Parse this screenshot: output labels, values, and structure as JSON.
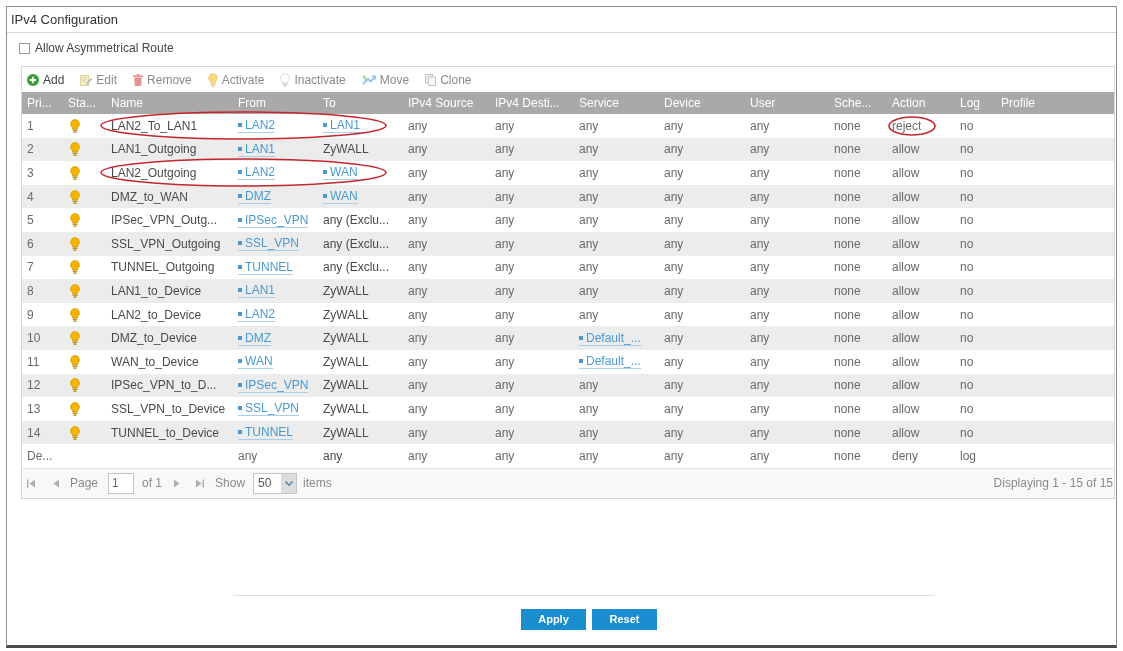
{
  "panel": {
    "title": "IPv4 Configuration"
  },
  "asymmetrical_route": {
    "label": "Allow Asymmetrical Route",
    "checked": false
  },
  "toolbar": [
    {
      "kind": "add",
      "label": "Add",
      "disabled": false
    },
    {
      "kind": "edit",
      "label": "Edit",
      "disabled": true
    },
    {
      "kind": "remove",
      "label": "Remove",
      "disabled": true
    },
    {
      "kind": "activate",
      "label": "Activate",
      "disabled": true
    },
    {
      "kind": "inactivate",
      "label": "Inactivate",
      "disabled": true
    },
    {
      "kind": "move",
      "label": "Move",
      "disabled": true
    },
    {
      "kind": "clone",
      "label": "Clone",
      "disabled": true
    }
  ],
  "table": {
    "columns": [
      "Pri...",
      "Sta...",
      "Name",
      "From",
      "To",
      "IPv4 Source",
      "IPv4 Desti...",
      "Service",
      "Device",
      "User",
      "Sche...",
      "Action",
      "Log",
      "Profile"
    ],
    "rows": [
      {
        "circled": true,
        "action_circled": true,
        "cells": [
          "1",
          {
            "kind": "bulb",
            "on": true
          },
          "LAN2_To_LAN1",
          {
            "kind": "link",
            "text": "LAN2"
          },
          {
            "kind": "link",
            "text": "LAN1"
          },
          "any",
          "any",
          "any",
          "any",
          "any",
          "none",
          "reject",
          "no"
        ]
      },
      {
        "circled": false,
        "action_circled": false,
        "cells": [
          "2",
          {
            "kind": "bulb",
            "on": true
          },
          "LAN1_Outgoing",
          {
            "kind": "link",
            "text": "LAN1"
          },
          "ZyWALL",
          "any",
          "any",
          "any",
          "any",
          "any",
          "none",
          "allow",
          "no"
        ]
      },
      {
        "circled": true,
        "action_circled": false,
        "cells": [
          "3",
          {
            "kind": "bulb",
            "on": true
          },
          "LAN2_Outgoing",
          {
            "kind": "link",
            "text": "LAN2"
          },
          {
            "kind": "link",
            "text": "WAN"
          },
          "any",
          "any",
          "any",
          "any",
          "any",
          "none",
          "allow",
          "no"
        ]
      },
      {
        "circled": false,
        "action_circled": false,
        "cells": [
          "4",
          {
            "kind": "bulb",
            "on": true
          },
          "DMZ_to_WAN",
          {
            "kind": "link",
            "text": "DMZ"
          },
          {
            "kind": "link",
            "text": "WAN"
          },
          "any",
          "any",
          "any",
          "any",
          "any",
          "none",
          "allow",
          "no"
        ]
      },
      {
        "circled": false,
        "action_circled": false,
        "cells": [
          "5",
          {
            "kind": "bulb",
            "on": true
          },
          "IPSec_VPN_Outg...",
          {
            "kind": "link",
            "text": "IPSec_VPN"
          },
          "any (Exclu...",
          "any",
          "any",
          "any",
          "any",
          "any",
          "none",
          "allow",
          "no"
        ]
      },
      {
        "circled": false,
        "action_circled": false,
        "cells": [
          "6",
          {
            "kind": "bulb",
            "on": true
          },
          "SSL_VPN_Outgoing",
          {
            "kind": "link",
            "text": "SSL_VPN"
          },
          "any (Exclu...",
          "any",
          "any",
          "any",
          "any",
          "any",
          "none",
          "allow",
          "no"
        ]
      },
      {
        "circled": false,
        "action_circled": false,
        "cells": [
          "7",
          {
            "kind": "bulb",
            "on": true
          },
          "TUNNEL_Outgoing",
          {
            "kind": "link",
            "text": "TUNNEL"
          },
          "any (Exclu...",
          "any",
          "any",
          "any",
          "any",
          "any",
          "none",
          "allow",
          "no"
        ]
      },
      {
        "circled": false,
        "action_circled": false,
        "cells": [
          "8",
          {
            "kind": "bulb",
            "on": true
          },
          "LAN1_to_Device",
          {
            "kind": "link",
            "text": "LAN1"
          },
          "ZyWALL",
          "any",
          "any",
          "any",
          "any",
          "any",
          "none",
          "allow",
          "no"
        ]
      },
      {
        "circled": false,
        "action_circled": false,
        "cells": [
          "9",
          {
            "kind": "bulb",
            "on": true
          },
          "LAN2_to_Device",
          {
            "kind": "link",
            "text": "LAN2"
          },
          "ZyWALL",
          "any",
          "any",
          "any",
          "any",
          "any",
          "none",
          "allow",
          "no"
        ]
      },
      {
        "circled": false,
        "action_circled": false,
        "cells": [
          "10",
          {
            "kind": "bulb",
            "on": true
          },
          "DMZ_to_Device",
          {
            "kind": "link",
            "text": "DMZ"
          },
          "ZyWALL",
          "any",
          "any",
          {
            "kind": "link",
            "text": "Default_..."
          },
          "any",
          "any",
          "none",
          "allow",
          "no"
        ]
      },
      {
        "circled": false,
        "action_circled": false,
        "cells": [
          "11",
          {
            "kind": "bulb",
            "on": true
          },
          "WAN_to_Device",
          {
            "kind": "link",
            "text": "WAN"
          },
          "ZyWALL",
          "any",
          "any",
          {
            "kind": "link",
            "text": "Default_..."
          },
          "any",
          "any",
          "none",
          "allow",
          "no"
        ]
      },
      {
        "circled": false,
        "action_circled": false,
        "cells": [
          "12",
          {
            "kind": "bulb",
            "on": true
          },
          "IPSec_VPN_to_D...",
          {
            "kind": "link",
            "text": "IPSec_VPN"
          },
          "ZyWALL",
          "any",
          "any",
          "any",
          "any",
          "any",
          "none",
          "allow",
          "no"
        ]
      },
      {
        "circled": false,
        "action_circled": false,
        "cells": [
          "13",
          {
            "kind": "bulb",
            "on": true
          },
          "SSL_VPN_to_Device",
          {
            "kind": "link",
            "text": "SSL_VPN"
          },
          "ZyWALL",
          "any",
          "any",
          "any",
          "any",
          "any",
          "none",
          "allow",
          "no"
        ]
      },
      {
        "circled": false,
        "action_circled": false,
        "cells": [
          "14",
          {
            "kind": "bulb",
            "on": true
          },
          "TUNNEL_to_Device",
          {
            "kind": "link",
            "text": "TUNNEL"
          },
          "ZyWALL",
          "any",
          "any",
          "any",
          "any",
          "any",
          "none",
          "allow",
          "no"
        ]
      },
      {
        "circled": false,
        "action_circled": false,
        "cells": [
          "De...",
          null,
          null,
          "any",
          "any",
          "any",
          "any",
          "any",
          "any",
          "any",
          "none",
          "deny",
          "log"
        ]
      }
    ],
    "pagination": {
      "page_label": "Page",
      "page": "1",
      "of_label": "of 1",
      "show_label": "Show",
      "page_size": "50",
      "items_label": "items",
      "summary": "Displaying 1 - 15 of 15"
    }
  },
  "buttons": [
    "Apply",
    "Reset"
  ]
}
